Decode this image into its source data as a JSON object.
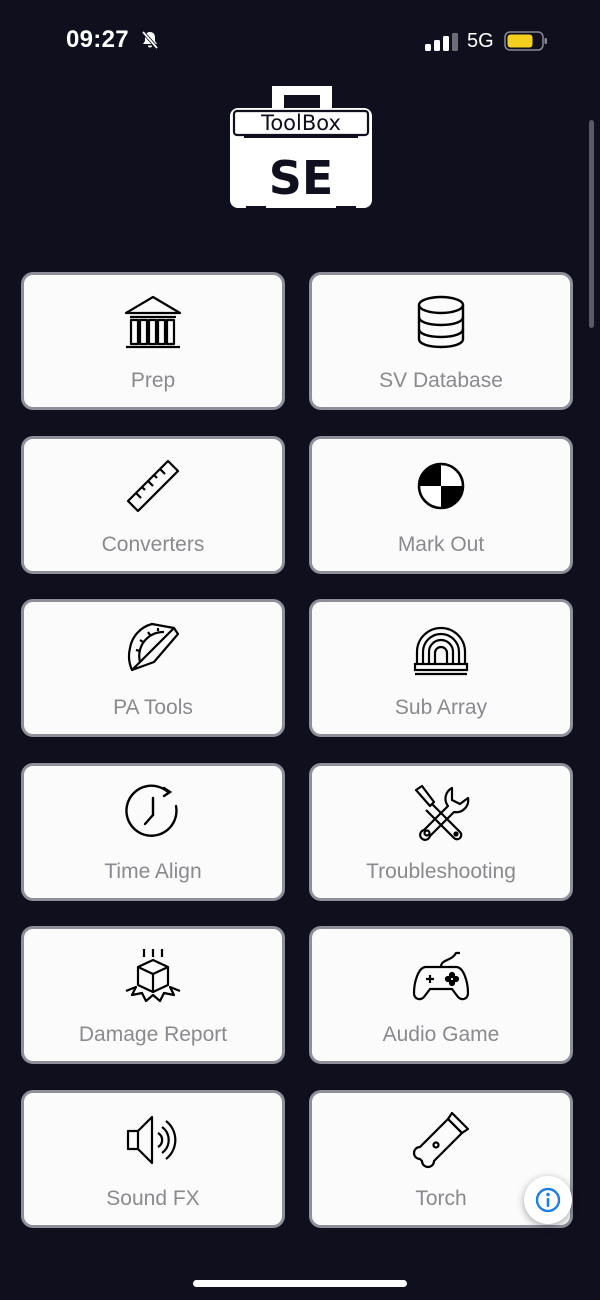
{
  "status": {
    "time": "09:27",
    "network": "5G",
    "battery_color": "#f5cf1d"
  },
  "logo": {
    "line1": "ToolBox",
    "line2": "SE"
  },
  "tiles": [
    {
      "label": "Prep",
      "icon": "library-icon"
    },
    {
      "label": "SV Database",
      "icon": "database-icon"
    },
    {
      "label": "Converters",
      "icon": "ruler-icon"
    },
    {
      "label": "Mark Out",
      "icon": "target-marker-icon"
    },
    {
      "label": "PA Tools",
      "icon": "protractor-icon"
    },
    {
      "label": "Sub Array",
      "icon": "sub-array-icon"
    },
    {
      "label": "Time Align",
      "icon": "clock-icon"
    },
    {
      "label": "Troubleshooting",
      "icon": "tools-icon"
    },
    {
      "label": "Damage Report",
      "icon": "damaged-box-icon"
    },
    {
      "label": "Audio Game",
      "icon": "gamepad-icon"
    },
    {
      "label": "Sound FX",
      "icon": "speaker-icon"
    },
    {
      "label": "Torch",
      "icon": "flashlight-icon"
    }
  ],
  "info_button": {
    "icon": "info-icon",
    "color": "#1e7fe0"
  },
  "colors": {
    "background": "#0f0f1e",
    "tile": "#fbfbfc",
    "tile_border": "#8f8f9a",
    "label": "#8a8a8e"
  }
}
